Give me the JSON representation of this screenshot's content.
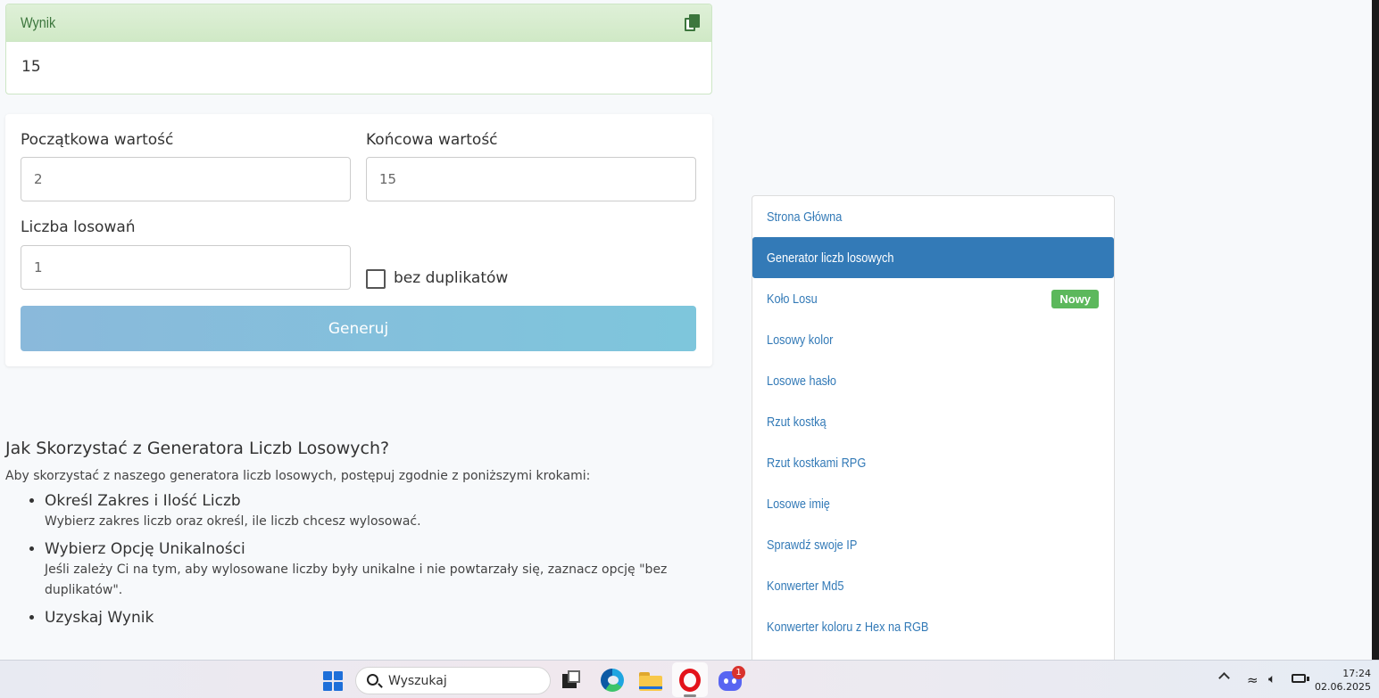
{
  "result": {
    "title": "Wynik",
    "value": "15"
  },
  "form": {
    "start_label": "Początkowa wartość",
    "start_value": "2",
    "end_label": "Końcowa wartość",
    "end_value": "15",
    "count_label": "Liczba losowań",
    "count_value": "1",
    "no_duplicates_label": "bez duplikatów",
    "no_duplicates_checked": false,
    "generate_label": "Generuj"
  },
  "article": {
    "heading": "Jak Skorzystać z Generatora Liczb Losowych?",
    "intro": "Aby skorzystać z naszego generatora liczb losowych, postępuj zgodnie z poniższymi krokami:",
    "steps": [
      {
        "title": "Określ Zakres i Ilość Liczb",
        "desc": "Wybierz zakres liczb oraz określ, ile liczb chcesz wylosować."
      },
      {
        "title": "Wybierz Opcję Unikalności",
        "desc": "Jeśli zależy Ci na tym, aby wylosowane liczby były unikalne i nie powtarzały się, zaznacz opcję \"bez duplikatów\"."
      },
      {
        "title": "Uzyskaj Wynik",
        "desc": ""
      }
    ]
  },
  "sidebar": {
    "items": [
      {
        "label": "Strona Główna"
      },
      {
        "label": "Generator liczb losowych",
        "active": true
      },
      {
        "label": "Koło Losu",
        "badge": "Nowy"
      },
      {
        "label": "Losowy kolor"
      },
      {
        "label": "Losowe hasło"
      },
      {
        "label": "Rzut kostką"
      },
      {
        "label": "Rzut kostkami RPG"
      },
      {
        "label": "Losowe imię"
      },
      {
        "label": "Sprawdź swoje IP"
      },
      {
        "label": "Konwerter Md5"
      },
      {
        "label": "Konwerter koloru z Hex na RGB"
      }
    ]
  },
  "taskbar": {
    "search_placeholder": "Wyszukaj",
    "discord_badge": "1",
    "time": "17:24",
    "date": "02.06.2025"
  },
  "colors": {
    "primary": "#337ab7",
    "success": "#5cb85c",
    "result_header_bg": "#dff0d8",
    "result_header_text": "#3c763d",
    "generate_button": "#7ec6dc"
  }
}
